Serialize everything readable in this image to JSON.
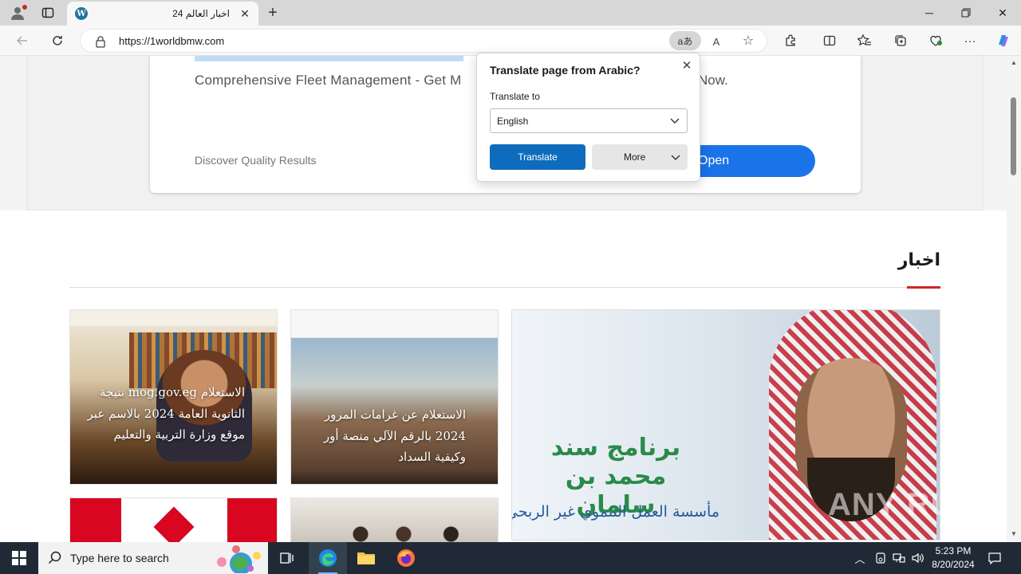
{
  "browser": {
    "tab_title": "اخبار العالم 24",
    "url": "https://1worldbmw.com",
    "translate_pill": "aあ",
    "read_aloud": "A"
  },
  "ad": {
    "headline": "Comprehensive Fleet Management - Get M",
    "headline_tail": "Now.",
    "subtext": "Discover Quality Results",
    "open_label": "Open"
  },
  "news": {
    "section_title": "اخبار",
    "cards": [
      {
        "caption": "الاستعلام mog.gov.eg نتيجة الثانوية العامة 2024 بالاسم عبر موقع وزارة التربية والتعليم"
      },
      {
        "caption": "الاستعلام عن غرامات المرور 2024 بالرقم الآلي منصة أور وكيفية السداد"
      },
      {
        "image_title": "برنامج سند محمد بن سلمان",
        "image_subtitle": "مأسسة العمل التنموي غير الربحي"
      }
    ]
  },
  "watermark": "ANY RUN",
  "translate_popup": {
    "heading": "Translate page from Arabic?",
    "label": "Translate to",
    "selected_language": "English",
    "translate_button": "Translate",
    "more_button": "More"
  },
  "taskbar": {
    "search_placeholder": "Type here to search",
    "time": "5:23 PM",
    "date": "8/20/2024"
  },
  "colors": {
    "accent_blue": "#0f6cbd",
    "ad_button": "#1a73e8",
    "section_accent": "#d0262a",
    "taskbar": "#1f2a36"
  }
}
